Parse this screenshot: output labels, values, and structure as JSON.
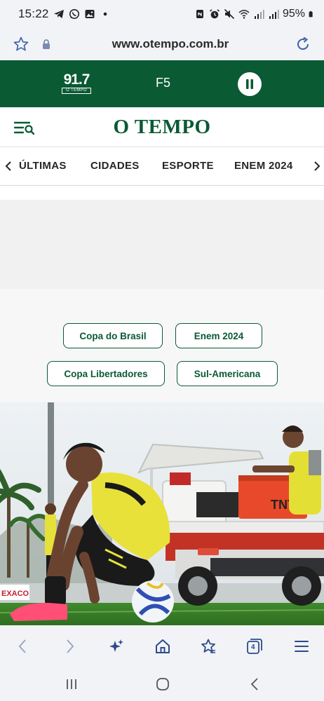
{
  "status_bar": {
    "time": "15:22",
    "battery": "95%",
    "left_icons": [
      "telegram-icon",
      "whatsapp-icon",
      "gallery-icon",
      "dot-icon"
    ],
    "right_icons": [
      "nfc-icon",
      "alarm-icon",
      "mute-icon",
      "wifi-icon",
      "signal-icon",
      "signal-icon",
      "battery-icon"
    ]
  },
  "browser": {
    "url": "www.otempo.com.br",
    "icons": [
      "star-icon",
      "lock-icon",
      "reload-icon"
    ]
  },
  "radio": {
    "logo_number": "91.7",
    "logo_sub": "O TEMPO",
    "station": "F5",
    "control_icon": "pause-icon"
  },
  "site": {
    "logo": "O TEMPO",
    "menu_icon": "menu-search-icon"
  },
  "nav": {
    "items": [
      "ÚLTIMAS",
      "CIDADES",
      "ESPORTE",
      "ENEM 2024"
    ]
  },
  "tags": [
    "Copa do Brasil",
    "Enem 2024",
    "Copa Libertadores",
    "Sul-Americana"
  ],
  "photo": {
    "cart_label": "TNT",
    "sign_text": "EXACO"
  },
  "toolbar": {
    "tabs_count": "4",
    "icons": [
      "back-icon",
      "forward-icon",
      "sparkle-icon",
      "home-icon",
      "bookmarks-icon",
      "tabs-icon",
      "menu-icon"
    ]
  },
  "colors": {
    "brand_green": "#0a5a34",
    "toolbar_blue": "#2c4a8a",
    "chrome_bg": "#f2f3f6"
  }
}
